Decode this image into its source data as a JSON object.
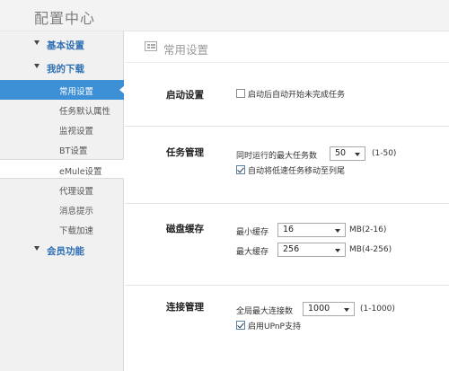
{
  "window": {
    "title": "配置中心"
  },
  "sidebar": {
    "groups": [
      {
        "label": "基本设置"
      },
      {
        "label": "我的下载"
      },
      {
        "label": "会员功能"
      }
    ],
    "items": [
      {
        "label": "常用设置"
      },
      {
        "label": "任务默认属性"
      },
      {
        "label": "监视设置"
      },
      {
        "label": "BT设置"
      },
      {
        "label": "eMule设置"
      },
      {
        "label": "代理设置"
      },
      {
        "label": "消息提示"
      },
      {
        "label": "下载加速"
      }
    ]
  },
  "main": {
    "title": "常用设置",
    "startup": {
      "label": "启动设置",
      "auto_start_label": "启动后自动开始未完成任务",
      "auto_start_checked": false
    },
    "tasks": {
      "label": "任务管理",
      "max_tasks_label": "同时运行的最大任务数",
      "max_tasks_value": "50",
      "max_tasks_range": "(1-50)",
      "move_slow_label": "自动将低速任务移动至列尾",
      "move_slow_checked": true
    },
    "disk_cache": {
      "label": "磁盘缓存",
      "min_label": "最小缓存",
      "min_value": "16",
      "min_unit": "MB(2-16)",
      "max_label": "最大缓存",
      "max_value": "256",
      "max_unit": "MB(4-256)"
    },
    "connection": {
      "label": "连接管理",
      "max_conn_label": "全局最大连接数",
      "max_conn_value": "1000",
      "max_conn_range": "(1-1000)",
      "upnp_label": "启用UPnP支持",
      "upnp_checked": true
    }
  },
  "colors": {
    "accent": "#3d8fd6",
    "group_text": "#2f6fb3",
    "sidebar_bg": "#f1f1f1"
  }
}
